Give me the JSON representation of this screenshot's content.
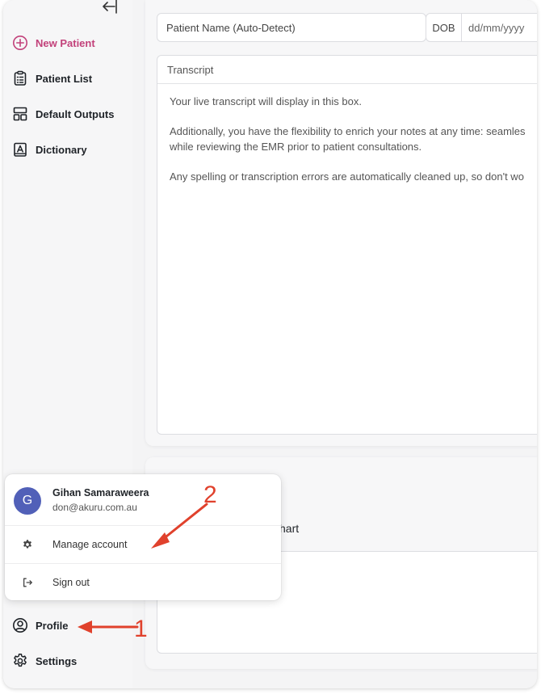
{
  "sidebar": {
    "items": [
      {
        "label": "New Patient",
        "icon": "plus-circle-icon"
      },
      {
        "label": "Patient List",
        "icon": "clipboard-list-icon"
      },
      {
        "label": "Default Outputs",
        "icon": "layout-icon"
      },
      {
        "label": "Dictionary",
        "icon": "book-icon"
      }
    ],
    "profile_label": "Profile",
    "settings_label": "Settings"
  },
  "form": {
    "patient_name_placeholder": "Patient Name (Auto-Detect)",
    "dob_label": "DOB",
    "dob_placeholder": "dd/mm/yyyy"
  },
  "transcript": {
    "header": "Transcript",
    "line1": "Your live transcript will display in this box.",
    "line2": "Additionally, you have the flexibility to enrich your notes at any time: seamles",
    "line3": "while reviewing the EMR prior to patient consultations.",
    "line4": "Any spelling or transcription errors are automatically cleaned up, so don't wo"
  },
  "lower_panel": {
    "label_fragment": "hart"
  },
  "account_menu": {
    "avatar_letter": "G",
    "name": "Gihan Samaraweera",
    "email": "don@akuru.com.au",
    "manage_label": "Manage account",
    "signout_label": "Sign out"
  },
  "annotations": {
    "step1": "1",
    "step2": "2",
    "color": "#e0412c"
  },
  "colors": {
    "accent": "#c2417a",
    "avatar": "#5160b8"
  }
}
